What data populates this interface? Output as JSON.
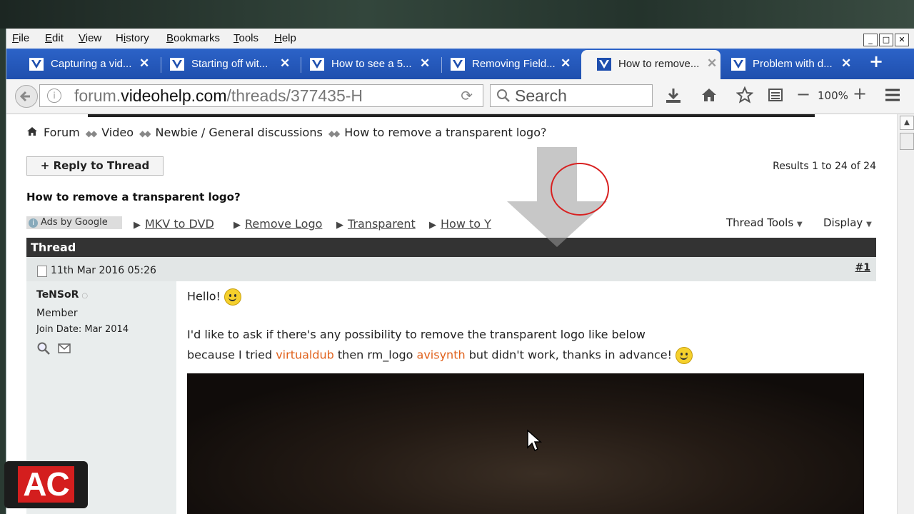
{
  "menubar": {
    "items": [
      {
        "label": "File"
      },
      {
        "label": "Edit"
      },
      {
        "label": "View"
      },
      {
        "label": "History"
      },
      {
        "label": "Bookmarks"
      },
      {
        "label": "Tools"
      },
      {
        "label": "Help"
      }
    ]
  },
  "tabs": [
    {
      "label": "Capturing a vid...",
      "active": false
    },
    {
      "label": "Starting off wit...",
      "active": false
    },
    {
      "label": "How to see a 5...",
      "active": false
    },
    {
      "label": "Removing Field...",
      "active": false
    },
    {
      "label": "How to remove...",
      "active": true
    },
    {
      "label": "Problem with d...",
      "active": false
    }
  ],
  "navbar": {
    "url_prefix": "forum.",
    "url_domain": "videohelp.com",
    "url_path": "/threads/377435-H",
    "search_placeholder": "Search",
    "zoom": "100%"
  },
  "breadcrumb": [
    "Forum",
    "Video",
    "Newbie / General discussions",
    "How to remove a transparent logo?"
  ],
  "thread": {
    "reply_label": "Reply to Thread",
    "results": "Results 1 to 24 of 24",
    "title": "How to remove a transparent logo?",
    "ads_label": "Ads by Google",
    "ad_links": [
      "MKV to DVD",
      "Remove Logo",
      "Transparent",
      "How to Y"
    ],
    "tools_label": "Thread Tools",
    "display_label": "Display",
    "bar_label": "Thread"
  },
  "post": {
    "date": "11th Mar 2016 05:26",
    "number": "#1",
    "user": {
      "name": "TeNSoR",
      "role": "Member",
      "join_date": "Join Date: Mar 2014"
    },
    "greeting": "Hello!",
    "line1": "I'd like to ask if there's any possibility to remove the transparent logo like below",
    "line2_a": "because I tried ",
    "line2_link1": "virtualdub",
    "line2_b": " then rm_logo ",
    "line2_link2": "avisynth",
    "line2_c": " but didn't work, thanks in advance!"
  },
  "overlay": {
    "channel_logo": "AC"
  },
  "colors": {
    "tab_strip": "#2c63c8",
    "thread_bar": "#333333",
    "link_orange": "#e0601a",
    "logo_red": "#d41e1e"
  }
}
